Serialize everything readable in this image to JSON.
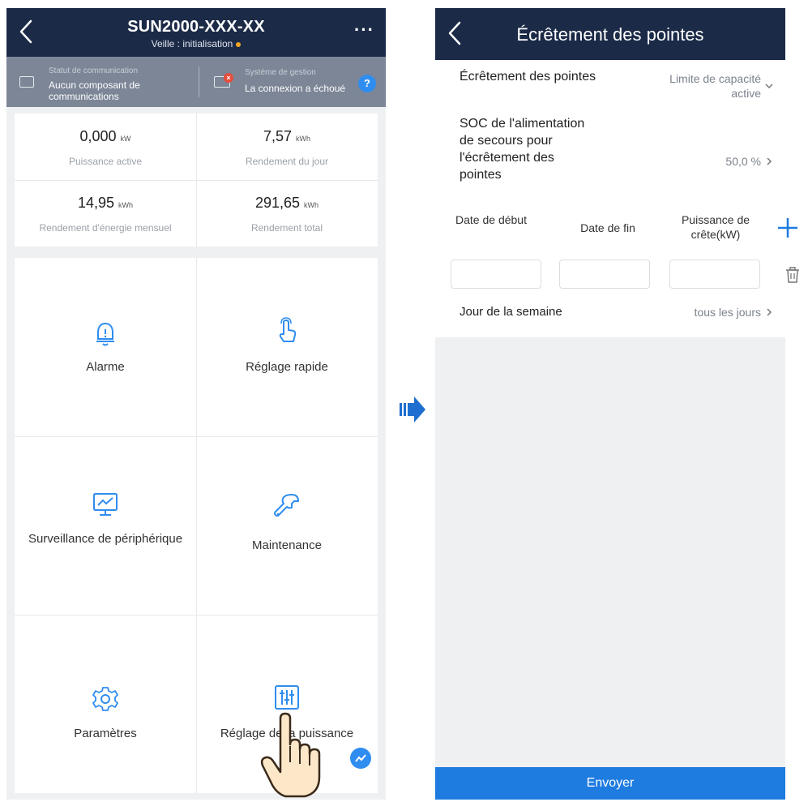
{
  "left": {
    "header": {
      "title": "SUN2000-XXX-XX",
      "subtitle": "Veille : initialisation",
      "more": "···"
    },
    "status": {
      "comm_caption": "Statut de communication",
      "comm_value": "Aucun composant de communications",
      "mgmt_caption": "Système de gestion",
      "mgmt_value": "La connexion a échoué",
      "help": "?"
    },
    "stats": [
      {
        "value": "0,000",
        "unit": "kW",
        "label": "Puissance active"
      },
      {
        "value": "7,57",
        "unit": "kWh",
        "label": "Rendement du jour"
      },
      {
        "value": "14,95",
        "unit": "kWh",
        "label": "Rendement d'énergie mensuel"
      },
      {
        "value": "291,65",
        "unit": "kWh",
        "label": "Rendement total"
      }
    ],
    "tiles": [
      {
        "label": "Alarme",
        "icon": "bell-icon"
      },
      {
        "label": "Réglage rapide",
        "icon": "touch-icon"
      },
      {
        "label": "Surveillance de périphérique",
        "icon": "monitor-icon"
      },
      {
        "label": "Maintenance",
        "icon": "wrench-icon"
      },
      {
        "label": "Paramètres",
        "icon": "gear-icon"
      },
      {
        "label": "Réglage de la puissance",
        "icon": "sliders-icon"
      }
    ]
  },
  "right": {
    "header": {
      "title": "Écrêtement des pointes"
    },
    "rows": {
      "mode_label": "Écrêtement des pointes",
      "mode_value": "Limite de capacité active",
      "soc_label": "SOC de l'alimentation de secours pour l'écrêtement des pointes",
      "soc_value": "50,0 %",
      "col_start": "Date de début",
      "col_end": "Date de fin",
      "col_power": "Puissance de crête(kW)",
      "week_label": "Jour de la semaine",
      "week_value": "tous les jours"
    },
    "submit": "Envoyer"
  },
  "colors": {
    "header_bg": "#1b2a47",
    "status_bg": "#7c8697",
    "accent_blue": "#1e7be0",
    "icon_blue": "#2f8df0"
  }
}
